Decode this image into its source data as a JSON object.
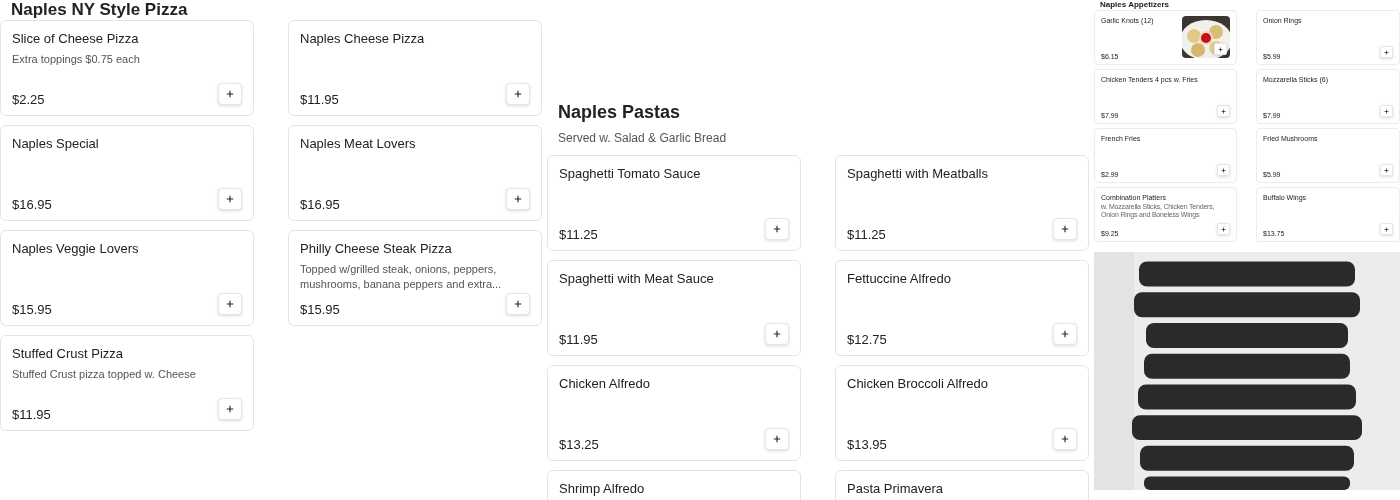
{
  "pizza_section": {
    "title": "Naples NY Style Pizza",
    "items": [
      {
        "name": "Slice of Cheese Pizza",
        "description": "Extra toppings $0.75 each",
        "price": "$2.25"
      },
      {
        "name": "Naples Cheese Pizza",
        "price": "$11.95"
      },
      {
        "name": "Naples Special",
        "price": "$16.95"
      },
      {
        "name": "Naples Meat Lovers",
        "price": "$16.95"
      },
      {
        "name": "Naples Veggie Lovers",
        "price": "$15.95"
      },
      {
        "name": "Philly Cheese Steak Pizza",
        "description": "Topped w/grilled steak, onions, peppers, mushrooms, banana peppers and extra...",
        "price": "$15.95"
      },
      {
        "name": "Stuffed Crust Pizza",
        "description": "Stuffed Crust pizza topped w. Cheese",
        "price": "$11.95"
      }
    ]
  },
  "pasta_section": {
    "title": "Naples Pastas",
    "subtitle": "Served w. Salad & Garlic Bread",
    "items": [
      {
        "name": "Spaghetti Tomato Sauce",
        "price": "$11.25"
      },
      {
        "name": "Spaghetti with Meatballs",
        "price": "$11.25"
      },
      {
        "name": "Spaghetti with Meat Sauce",
        "price": "$11.95"
      },
      {
        "name": "Fettuccine Alfredo",
        "price": "$12.75"
      },
      {
        "name": "Chicken Alfredo",
        "price": "$13.25"
      },
      {
        "name": "Chicken Broccoli Alfredo",
        "price": "$13.95"
      },
      {
        "name": "Shrimp Alfredo"
      },
      {
        "name": "Pasta Primavera"
      }
    ]
  },
  "appetizers_section": {
    "title": "Naples Appetizers",
    "items": [
      {
        "name": "Garlic Knots (12)",
        "price": "$6.15"
      },
      {
        "name": "Onion Rings",
        "price": "$5.99"
      },
      {
        "name": "Chicken Tenders 4 pcs w. Fries",
        "price": "$7.99"
      },
      {
        "name": "Mozzarella Sticks (6)",
        "price": "$7.99"
      },
      {
        "name": "French Fries",
        "price": "$2.99"
      },
      {
        "name": "Fried Mushrooms",
        "price": "$5.99"
      },
      {
        "name": "Combination Platters",
        "description": "w. Mozzarella Sticks, Chicken Tenders, Onion Rings and Boneless Wings",
        "price": "$9.25"
      },
      {
        "name": "Buffalo Wings",
        "price": "$13.75"
      }
    ]
  }
}
